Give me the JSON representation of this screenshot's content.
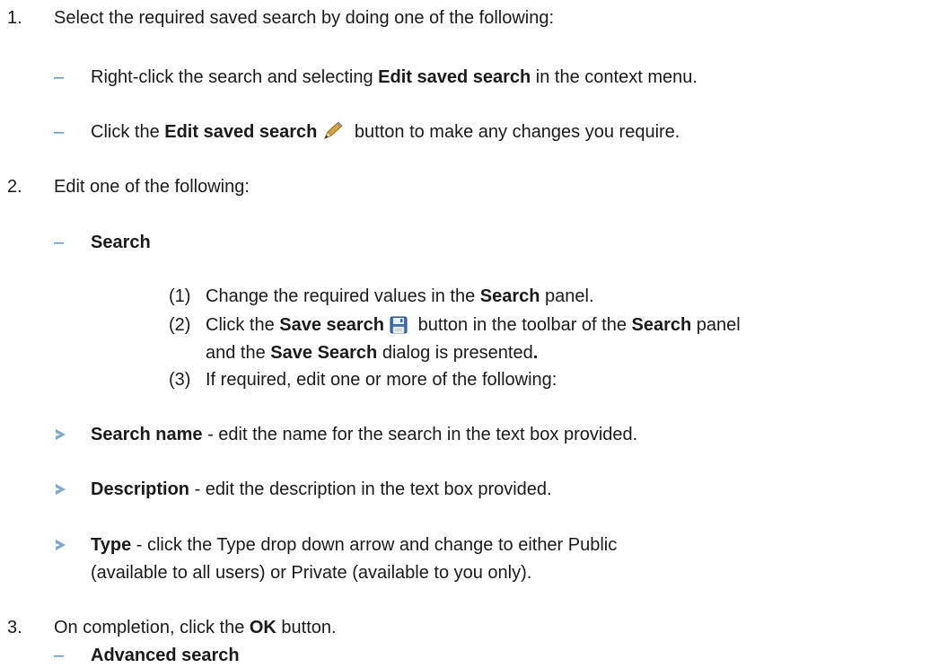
{
  "steps": [
    {
      "num": "1.",
      "text": "Select the required saved search by doing one of the following:"
    },
    {
      "num": "2.",
      "text": "Edit one of the following:"
    },
    {
      "num": "3.",
      "pre": "On completion, click the ",
      "bold": "OK",
      "post": " button."
    }
  ],
  "step1_options": [
    {
      "pre": "Right-click the search and selecting ",
      "bold": "Edit saved search",
      "post": " in the context menu."
    },
    {
      "pre": "Click the ",
      "bold": "Edit saved search",
      "post": " button to make any changes you require."
    }
  ],
  "search_heading": "Search",
  "search_substeps": [
    {
      "num": "(1)",
      "pre": "Change the required values in the ",
      "bold": "Search",
      "post": " panel."
    },
    {
      "num": "(2)",
      "pre": "Click the ",
      "bold": "Save search",
      "mid": " button in the toolbar of the ",
      "bold2": "Search",
      "post": " panel"
    },
    {
      "cont_pre": "and the ",
      "cont_bold": "Save Search",
      "cont_mid": " dialog is presented",
      "cont_bold2": "."
    },
    {
      "num": "(3)",
      "pre": "If required, edit one or more of the following:"
    }
  ],
  "fields": [
    {
      "bold": "Search name",
      "post": " - edit the name for the search in the text box provided."
    },
    {
      "bold": "Description",
      "post": " - edit the description in the text box provided."
    },
    {
      "bold": "Type",
      "post": " - click the Type drop down arrow and change to either Public"
    },
    {
      "post": "(available to all users) or Private (available to you only)."
    }
  ],
  "advanced_heading": "Advanced search",
  "icons": {
    "edit": "pencil-icon",
    "save": "floppy-disk-icon"
  },
  "colors": {
    "dash": "#4a90c8",
    "arrow": "#7aa7d0"
  }
}
